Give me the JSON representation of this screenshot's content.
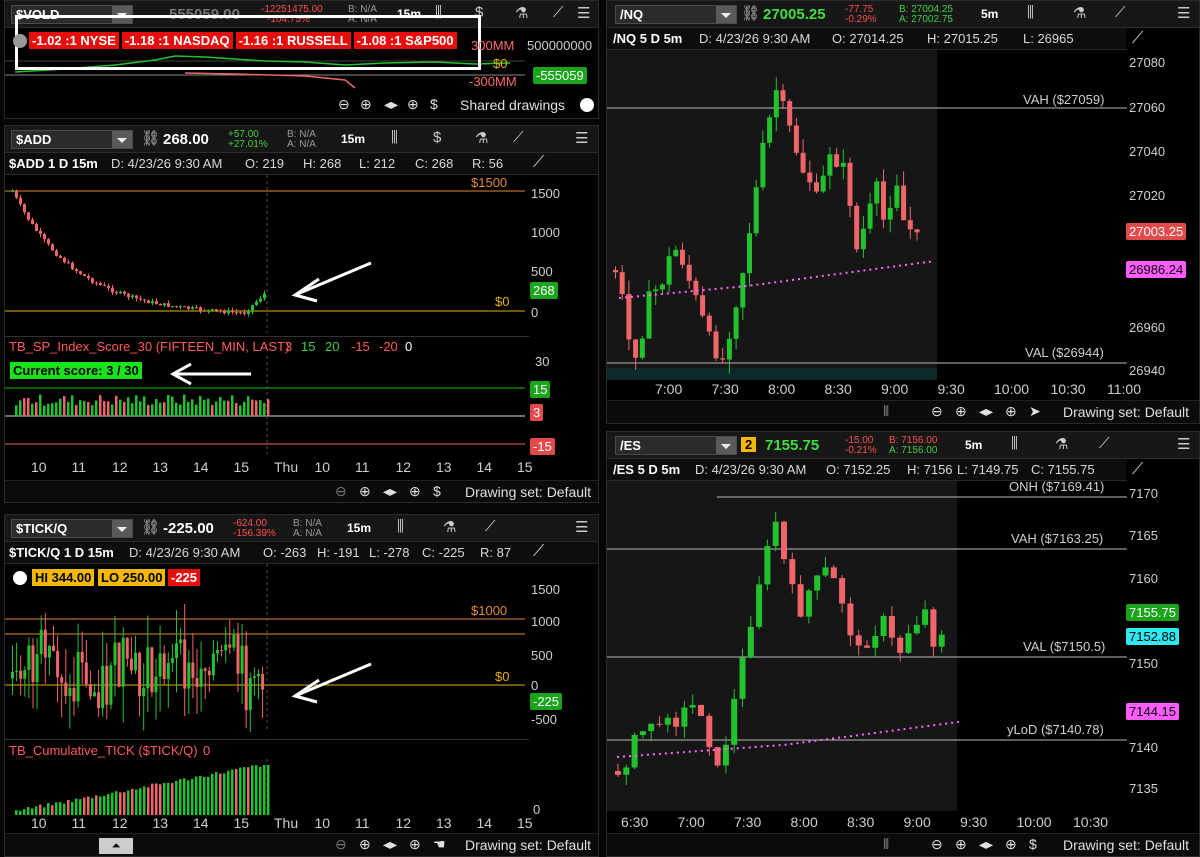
{
  "colors": {
    "up": "#22c22e",
    "down": "#f0656a",
    "orange": "#e58a30",
    "green": "#19d31a",
    "red": "#ee1d1d",
    "vwap": "#ff66ff"
  },
  "vold": {
    "symbol": "$VOLD",
    "price": "555059.00",
    "change": "-12251475.00",
    "change_pct": "-104.75%",
    "bid": "B: N/A",
    "ask": "A: N/A",
    "timeframe": "15m",
    "breadth": [
      "-1.02 :1 NYSE",
      "-1.18 :1 NASDAQ",
      "-1.16 :1 RUSSELL",
      "-1.08 :1 S&P500"
    ],
    "axis": [
      "500000000",
      "300MM",
      "$0",
      "-300MM"
    ],
    "price_tag": "-555059",
    "drawings": "Shared drawings"
  },
  "add": {
    "symbol": "$ADD",
    "price": "268.00",
    "change": "+57.00",
    "change_pct": "+27.01%",
    "bid": "B: N/A",
    "ask": "A: N/A",
    "timeframe": "15m",
    "title": "$ADD 1 D 15m",
    "date": "D: 4/23/26 9:30 AM",
    "open": "O: 219",
    "high": "H: 268",
    "low": "L: 212",
    "close": "C: 268",
    "range": "R: 56",
    "axis": [
      "1500",
      "1000",
      "500",
      "0"
    ],
    "level_hi": "$1500",
    "level_zero": "$0",
    "price_tag": "268",
    "study": "TB_SP_Index_Score_30 (FIFTEEN_MIN, LAST)",
    "study_vals": [
      "3",
      "15",
      "20",
      "-15",
      "-20",
      "0"
    ],
    "score": "Current score: 3 / 30",
    "study_axis_top": "30",
    "study_tags": [
      "15",
      "3",
      "-15"
    ],
    "times": [
      "10",
      "11",
      "12",
      "13",
      "14",
      "15",
      "Thu",
      "10",
      "11",
      "12",
      "13",
      "14",
      "15"
    ],
    "drawing_set": "Drawing set: Default"
  },
  "tick": {
    "symbol": "$TICK/Q",
    "price": "-225.00",
    "change": "-624.00",
    "change_pct": "-156.39%",
    "bid": "B: N/A",
    "ask": "A: N/A",
    "timeframe": "15m",
    "title": "$TICK/Q 1 D 15m",
    "date": "D: 4/23/26 9:30 AM",
    "open": "O: -263",
    "high": "H: -191",
    "low": "L: -278",
    "close": "C: -225",
    "range": "R: 87",
    "hi": "HI 344.00",
    "lo": "LO 250.00",
    "last": "-225",
    "axis": [
      "1500",
      "1000",
      "500",
      "0",
      "-500"
    ],
    "level_hi": "$1000",
    "level_zero": "$0",
    "price_tag": "-225",
    "study": "TB_Cumulative_TICK ($TICK/Q)",
    "study_val": "0",
    "study_axis": "0",
    "times": [
      "10",
      "11",
      "12",
      "13",
      "14",
      "15",
      "Thu",
      "10",
      "11",
      "12",
      "13",
      "14",
      "15"
    ],
    "drawing_set": "Drawing set: Default"
  },
  "nq": {
    "symbol": "/NQ",
    "price": "27005.25",
    "change": "-77.75",
    "change_pct": "-0.29%",
    "bid": "B: 27004.25",
    "ask": "A: 27002.75",
    "timeframe": "5m",
    "title": "/NQ 5 D 5m",
    "date": "D: 4/23/26 9:30 AM",
    "open": "O: 27014.25",
    "high": "H: 27015.25",
    "low": "L: 26965",
    "axis": [
      "27080",
      "27060",
      "27040",
      "27020",
      "27000",
      "26980",
      "26960",
      "26940"
    ],
    "vah": "VAH ($27059)",
    "val": "VAL ($26944)",
    "price_tag": "27003.25",
    "vwap_tag": "26986.24",
    "times": [
      "7:00",
      "7:30",
      "8:00",
      "8:30",
      "9:00",
      "9:30",
      "10:00",
      "10:30",
      "11:00"
    ],
    "drawing_set": "Drawing set: Default"
  },
  "es": {
    "symbol": "/ES",
    "price": "7155.75",
    "change": "-15.00",
    "change_pct": "-0.21%",
    "bid": "B: 7156.00",
    "ask": "A: 7156.00",
    "timeframe": "5m",
    "badge": "2",
    "title": "/ES 5 D 5m",
    "date": "D: 4/23/26 9:30 AM",
    "open": "O: 7152.25",
    "high": "H: 7156",
    "low": "L: 7149.75",
    "close": "C: 7155.75",
    "axis": [
      "7170",
      "7165",
      "7160",
      "7155",
      "7150",
      "7145",
      "7140",
      "7135"
    ],
    "onh": "ONH ($7169.41)",
    "vah": "VAH ($7163.25)",
    "val": "VAL ($7150.5)",
    "ylod": "yLoD ($7140.78)",
    "price_tag": "7155.75",
    "tag2": "7152.88",
    "vwap_tag": "7144.15",
    "times": [
      "6:30",
      "7:00",
      "7:30",
      "8:00",
      "8:30",
      "9:00",
      "9:30",
      "10:00",
      "10:30"
    ],
    "drawing_set": "Drawing set: Default"
  }
}
